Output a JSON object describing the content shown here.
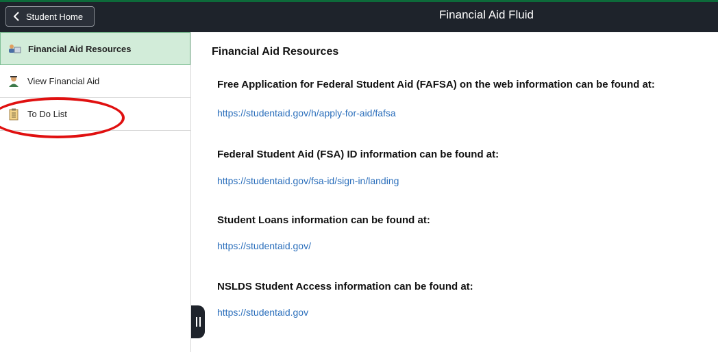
{
  "header": {
    "back_label": "Student Home",
    "title": "Financial Aid Fluid"
  },
  "sidebar": {
    "items": [
      {
        "label": "Financial Aid Resources",
        "icon": "resources-icon",
        "active": true
      },
      {
        "label": "View Financial Aid",
        "icon": "student-person-icon",
        "active": false
      },
      {
        "label": "To Do List",
        "icon": "clipboard-icon",
        "active": false
      }
    ]
  },
  "main": {
    "title": "Financial Aid Resources",
    "sections": [
      {
        "heading": "Free Application for Federal Student Aid (FAFSA) on the web information can be found at:",
        "link": "https://studentaid.gov/h/apply-for-aid/fafsa"
      },
      {
        "heading": "Federal Student Aid (FSA) ID information can be found at:",
        "link": "https://studentaid.gov/fsa-id/sign-in/landing"
      },
      {
        "heading": "Student Loans information can be found at:",
        "link": "https://studentaid.gov/"
      },
      {
        "heading": "NSLDS Student Access information can be found at:",
        "link": "https://studentaid.gov"
      }
    ]
  },
  "colors": {
    "header_bg": "#1e232b",
    "active_item_bg": "#d2ecd9",
    "link": "#2a6ebb",
    "annotation": "#e01010"
  }
}
